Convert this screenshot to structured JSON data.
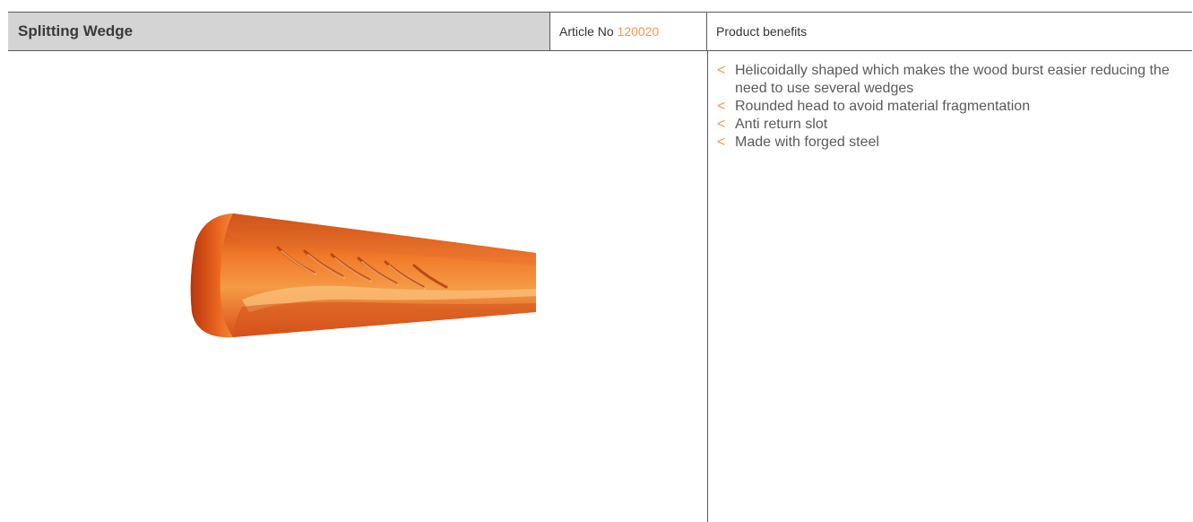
{
  "header": {
    "title": "Splitting Wedge",
    "article_label": "Article No",
    "article_number": "120020",
    "benefits_label": "Product benefits"
  },
  "benefits": [
    "Helicoidally shaped which makes the wood burst easier reducing the need to use several wedges",
    "Rounded head to avoid material fragmentation",
    "Anti return slot",
    "Made with forged steel"
  ],
  "bullet_glyph": "<",
  "colors": {
    "accent": "#f39a4a",
    "header_bg": "#d4d4d4",
    "border": "#5a5a5a",
    "product_orange": "#e8541a"
  },
  "image": {
    "subject": "splitting-wedge-image"
  }
}
